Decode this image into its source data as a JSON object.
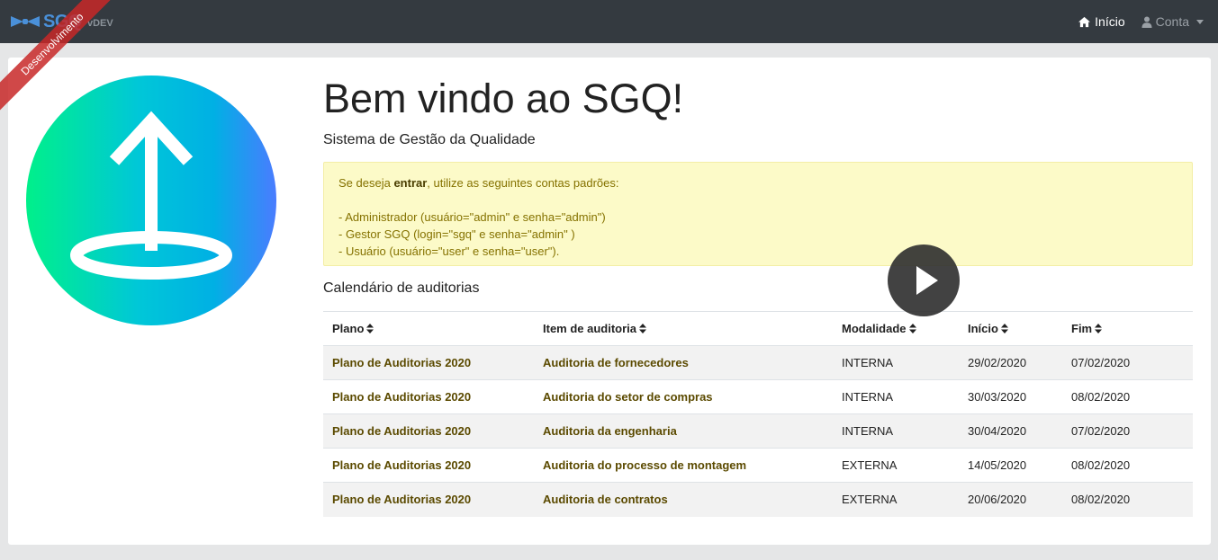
{
  "navbar": {
    "brand_text": "SGQ",
    "version": "vDEV",
    "home_label": "Início",
    "account_label": "Conta"
  },
  "ribbon": {
    "label": "Desenvolvimento"
  },
  "main": {
    "title": "Bem vindo ao SGQ!",
    "subtitle": "Sistema de Gestão da Qualidade",
    "alert": {
      "intro_before": "Se deseja ",
      "intro_bold": "entrar",
      "intro_after": ", utilize as seguintes contas padrões:",
      "lines": [
        "- Administrador (usuário=\"admin\" e senha=\"admin\")",
        "- Gestor SGQ (login=\"sgq\" e senha=\"admin\" )",
        "- Usuário (usuário=\"user\" e senha=\"user\")."
      ]
    },
    "calendar_title": "Calendário de auditorias",
    "table": {
      "headers": [
        "Plano",
        "Item de auditoria",
        "Modalidade",
        "Início",
        "Fim"
      ],
      "rows": [
        [
          "Plano de Auditorias 2020",
          "Auditoria de fornecedores",
          "INTERNA",
          "29/02/2020",
          "07/02/2020"
        ],
        [
          "Plano de Auditorias 2020",
          "Auditoria do setor de compras",
          "INTERNA",
          "30/03/2020",
          "08/02/2020"
        ],
        [
          "Plano de Auditorias 2020",
          "Auditoria da engenharia",
          "INTERNA",
          "30/04/2020",
          "07/02/2020"
        ],
        [
          "Plano de Auditorias 2020",
          "Auditoria do processo de montagem",
          "EXTERNA",
          "14/05/2020",
          "08/02/2020"
        ],
        [
          "Plano de Auditorias 2020",
          "Auditoria de contratos",
          "EXTERNA",
          "20/06/2020",
          "08/02/2020"
        ]
      ]
    }
  },
  "colors": {
    "navbar_bg": "#343a40",
    "alert_bg": "#fcfac8",
    "link": "#5b4a00",
    "logo_gradient": [
      "#00f08a",
      "#00b4e0",
      "#4a7cff"
    ]
  },
  "icons": {
    "brand": "bowtie-logo-icon",
    "home": "home-icon",
    "account": "user-icon",
    "hero": "upload-arrow-logo-icon",
    "sort": "sort-icon",
    "play": "play-icon"
  }
}
